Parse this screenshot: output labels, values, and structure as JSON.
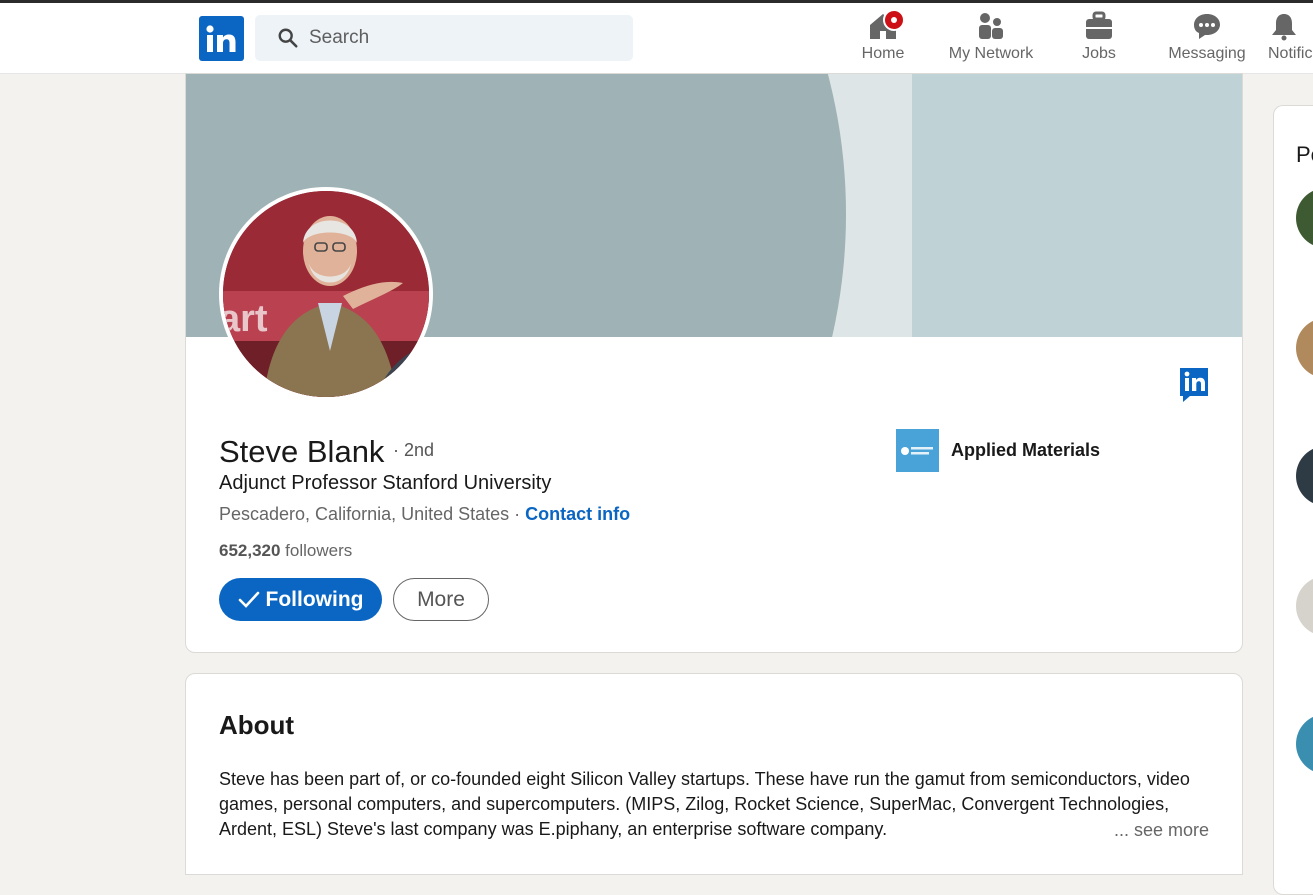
{
  "nav": {
    "search_placeholder": "Search",
    "items": [
      {
        "label": "Home",
        "icon": "home-icon"
      },
      {
        "label": "My Network",
        "icon": "people-icon"
      },
      {
        "label": "Jobs",
        "icon": "briefcase-icon"
      },
      {
        "label": "Messaging",
        "icon": "chat-icon"
      },
      {
        "label": "Notifications",
        "icon": "bell-icon"
      }
    ]
  },
  "profile": {
    "name": "Steve Blank",
    "degree": "· 2nd",
    "headline": "Adjunct Professor Stanford University",
    "location": "Pescadero, California, United States",
    "separator": " · ",
    "contact_label": "Contact info",
    "followers_count": "652,320",
    "followers_label": " followers",
    "following_button": "Following",
    "more_button": "More",
    "company": "Applied Materials"
  },
  "about": {
    "title": "About",
    "text": "Steve has been part of, or co-founded eight Silicon Valley startups. These have run the gamut from semiconductors, video games, personal computers, and supercomputers. (MIPS, Zilog, Rocket Science, SuperMac, Convergent Technologies, Ardent, ESL) Steve's last company was E.piphany, an enterprise software company.",
    "see_more": "... see more"
  },
  "sidebar": {
    "title": "Pe"
  },
  "colors": {
    "brand_blue": "#0a66c2",
    "badge_red": "#cc1016",
    "page_bg": "#f3f2ef"
  }
}
